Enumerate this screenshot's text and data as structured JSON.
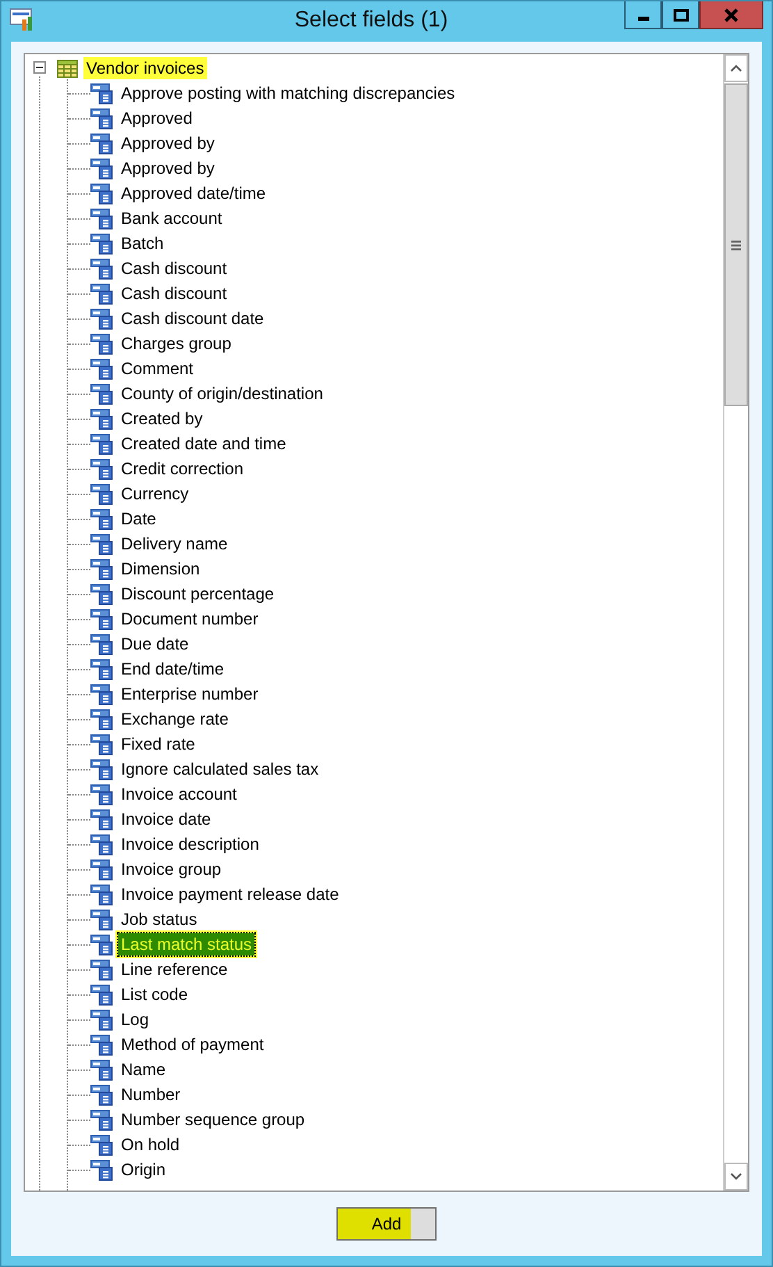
{
  "window": {
    "title": "Select fields (1)"
  },
  "tree": {
    "root": {
      "label": "Vendor invoices",
      "expanded": true,
      "highlighted": true,
      "children": [
        {
          "label": "Approve posting with matching discrepancies",
          "selected": false
        },
        {
          "label": "Approved",
          "selected": false
        },
        {
          "label": "Approved by",
          "selected": false
        },
        {
          "label": "Approved by",
          "selected": false
        },
        {
          "label": "Approved date/time",
          "selected": false
        },
        {
          "label": "Bank account",
          "selected": false
        },
        {
          "label": "Batch",
          "selected": false
        },
        {
          "label": "Cash discount",
          "selected": false
        },
        {
          "label": "Cash discount",
          "selected": false
        },
        {
          "label": "Cash discount date",
          "selected": false
        },
        {
          "label": "Charges group",
          "selected": false
        },
        {
          "label": "Comment",
          "selected": false
        },
        {
          "label": "County of origin/destination",
          "selected": false
        },
        {
          "label": "Created by",
          "selected": false
        },
        {
          "label": "Created date and time",
          "selected": false
        },
        {
          "label": "Credit correction",
          "selected": false
        },
        {
          "label": "Currency",
          "selected": false
        },
        {
          "label": "Date",
          "selected": false
        },
        {
          "label": "Delivery name",
          "selected": false
        },
        {
          "label": "Dimension",
          "selected": false
        },
        {
          "label": "Discount percentage",
          "selected": false
        },
        {
          "label": "Document number",
          "selected": false
        },
        {
          "label": "Due date",
          "selected": false
        },
        {
          "label": "End date/time",
          "selected": false
        },
        {
          "label": "Enterprise number",
          "selected": false
        },
        {
          "label": "Exchange rate",
          "selected": false
        },
        {
          "label": "Fixed rate",
          "selected": false
        },
        {
          "label": "Ignore calculated sales tax",
          "selected": false
        },
        {
          "label": "Invoice account",
          "selected": false
        },
        {
          "label": "Invoice date",
          "selected": false
        },
        {
          "label": "Invoice description",
          "selected": false
        },
        {
          "label": "Invoice group",
          "selected": false
        },
        {
          "label": "Invoice payment release date",
          "selected": false
        },
        {
          "label": "Job status",
          "selected": false
        },
        {
          "label": "Last match status",
          "selected": true
        },
        {
          "label": "Line reference",
          "selected": false
        },
        {
          "label": "List code",
          "selected": false
        },
        {
          "label": "Log",
          "selected": false
        },
        {
          "label": "Method of payment",
          "selected": false
        },
        {
          "label": "Name",
          "selected": false
        },
        {
          "label": "Number",
          "selected": false
        },
        {
          "label": "Number sequence group",
          "selected": false
        },
        {
          "label": "On hold",
          "selected": false
        },
        {
          "label": "Origin",
          "selected": false
        }
      ]
    }
  },
  "buttons": [
    {
      "label": "Add",
      "highlighted": true
    }
  ]
}
